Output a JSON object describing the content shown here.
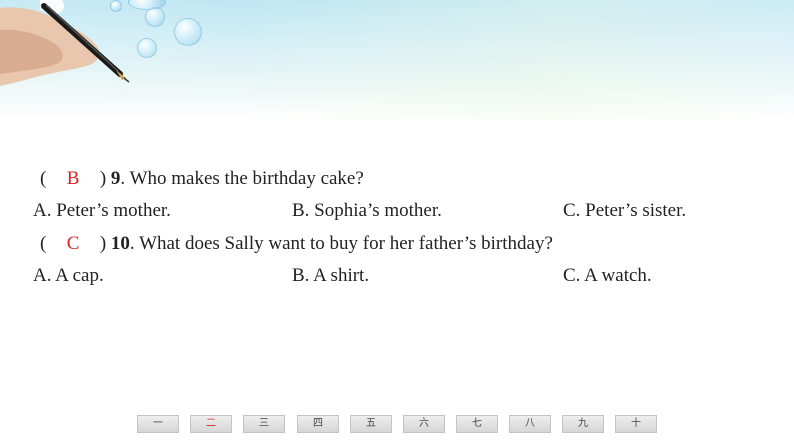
{
  "questions": [
    {
      "paren_open": "(",
      "answer": "B",
      "paren_close": ")",
      "number": "9",
      "text": ". Who makes the birthday cake?",
      "options": [
        "A. Peter’s mother.",
        "B. Sophia’s mother.",
        "C. Peter’s sister."
      ]
    },
    {
      "paren_open": "(",
      "answer": "C",
      "paren_close": ")",
      "number": "10",
      "text": ". What does Sally want to buy for her father’s birthday?",
      "options": [
        "A. A cap.",
        "B. A shirt.",
        "C. A watch."
      ]
    }
  ],
  "nav": {
    "active_index": 1,
    "buttons": [
      "一",
      "二",
      "三",
      "四",
      "五",
      "六",
      "七",
      "八",
      "九",
      "十"
    ]
  },
  "colors": {
    "answer": "#e02020",
    "text": "#222222",
    "banner_top": "#bfe6f3"
  }
}
